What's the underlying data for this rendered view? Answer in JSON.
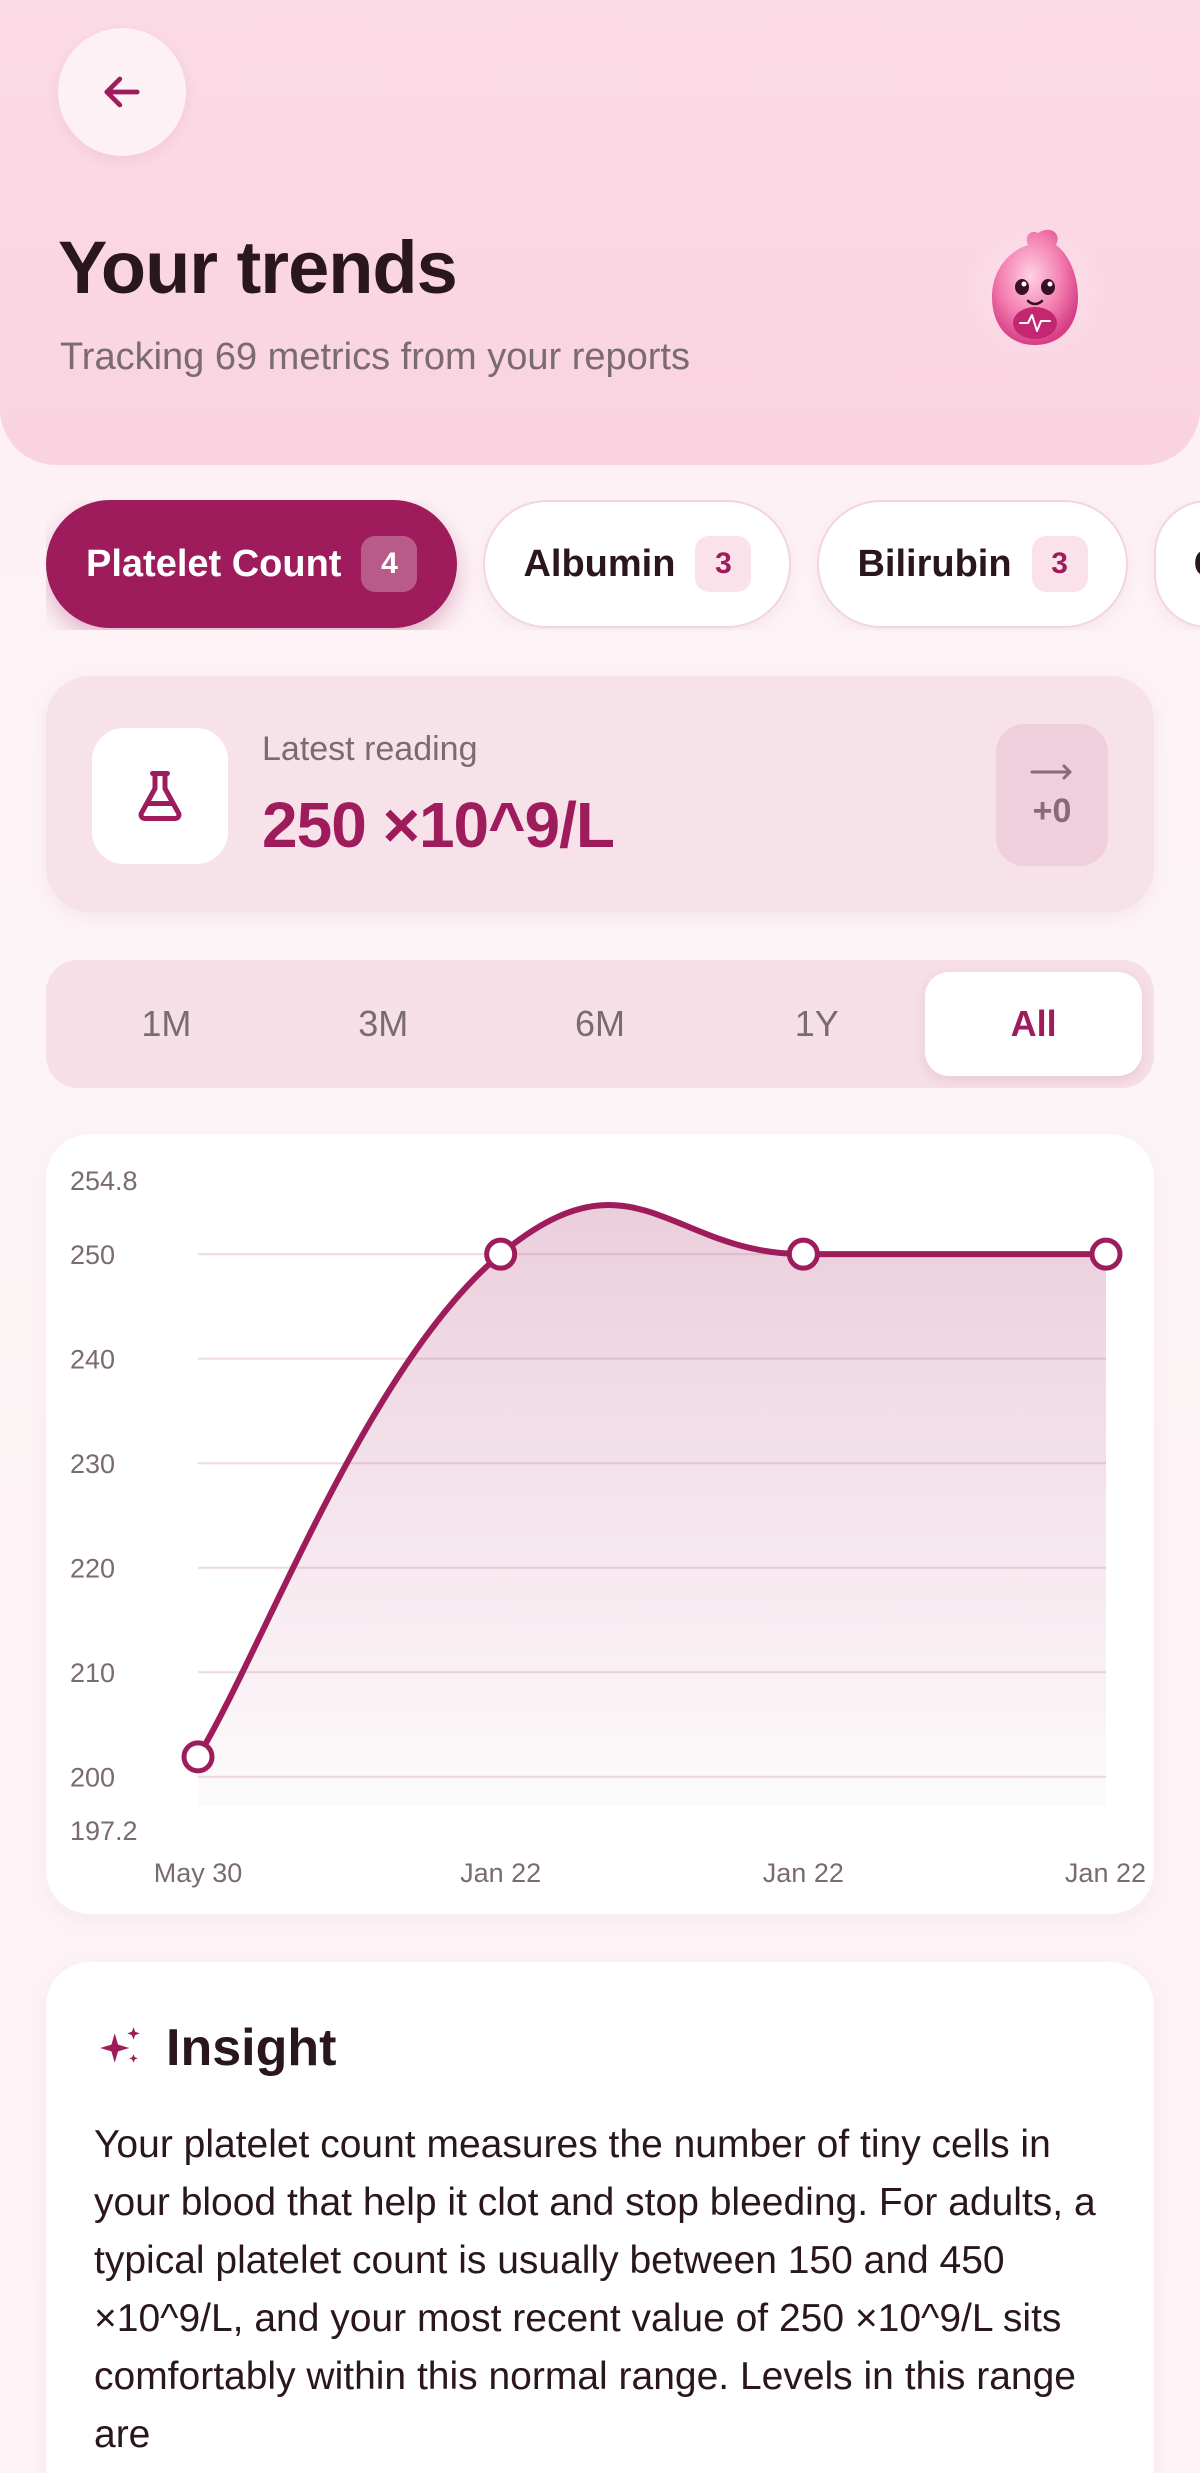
{
  "header": {
    "back_label": "Back",
    "title": "Your trends",
    "subtitle": "Tracking 69 metrics from your reports"
  },
  "metric_tabs": [
    {
      "label": "Platelet Count",
      "count": "4",
      "active": true
    },
    {
      "label": "Albumin",
      "count": "3",
      "active": false
    },
    {
      "label": "Bilirubin",
      "count": "3",
      "active": false
    },
    {
      "label": "C",
      "count": "",
      "active": false
    }
  ],
  "latest": {
    "label": "Latest reading",
    "value": "250 ×10^9/L",
    "delta": "+0",
    "trend_icon": "arrow-right-icon"
  },
  "ranges": [
    {
      "label": "1M",
      "active": false
    },
    {
      "label": "3M",
      "active": false
    },
    {
      "label": "6M",
      "active": false
    },
    {
      "label": "1Y",
      "active": false
    },
    {
      "label": "All",
      "active": true
    }
  ],
  "colors": {
    "accent": "#9e1c5c",
    "accent_light": "#f8e2ea"
  },
  "chart_data": {
    "type": "area",
    "x": [
      "May 30",
      "Jan 22",
      "Jan 22",
      "Jan 22"
    ],
    "values": [
      201.9,
      250,
      250,
      250
    ],
    "ylim": [
      197.2,
      254.8
    ],
    "yticks": [
      200,
      210,
      220,
      230,
      240,
      250
    ],
    "ytick_labels": [
      "200",
      "210",
      "220",
      "230",
      "240",
      "250"
    ],
    "ymin_label": "197.2",
    "ymax_label": "254.8",
    "grid": true
  },
  "insight": {
    "title": "Insight",
    "body": "Your platelet count measures the number of tiny cells in your blood that help it clot and stop bleeding. For adults, a typical platelet count is usually between 150 and 450 ×10^9/L, and your most recent value of 250 ×10^9/L sits comfortably within this normal range. Levels in this range are"
  }
}
